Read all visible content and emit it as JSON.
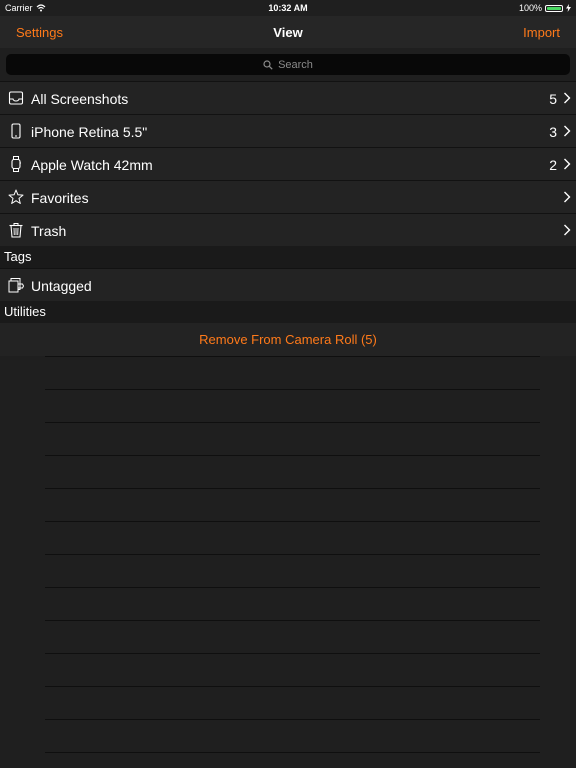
{
  "status_bar": {
    "carrier": "Carrier",
    "time": "10:32 AM",
    "battery": "100%"
  },
  "nav": {
    "left_button": "Settings",
    "title": "View",
    "right_button": "Import"
  },
  "search": {
    "placeholder": "Search"
  },
  "library": [
    {
      "label": "All Screenshots",
      "count": "5",
      "icon": "tray-icon"
    },
    {
      "label": "iPhone Retina 5.5\"",
      "count": "3",
      "icon": "iphone-icon"
    },
    {
      "label": "Apple Watch 42mm",
      "count": "2",
      "icon": "watch-icon"
    },
    {
      "label": "Favorites",
      "count": "",
      "icon": "star-icon"
    },
    {
      "label": "Trash",
      "count": "",
      "icon": "trash-icon"
    }
  ],
  "tags": {
    "header": "Tags",
    "items": [
      {
        "label": "Untagged",
        "icon": "tag-untagged-icon"
      }
    ]
  },
  "utilities": {
    "header": "Utilities",
    "action": "Remove From Camera Roll (5)"
  },
  "colors": {
    "accent": "#ff7a1a",
    "background": "#1f1f1f",
    "row": "#232323",
    "battery": "#4cd964"
  }
}
